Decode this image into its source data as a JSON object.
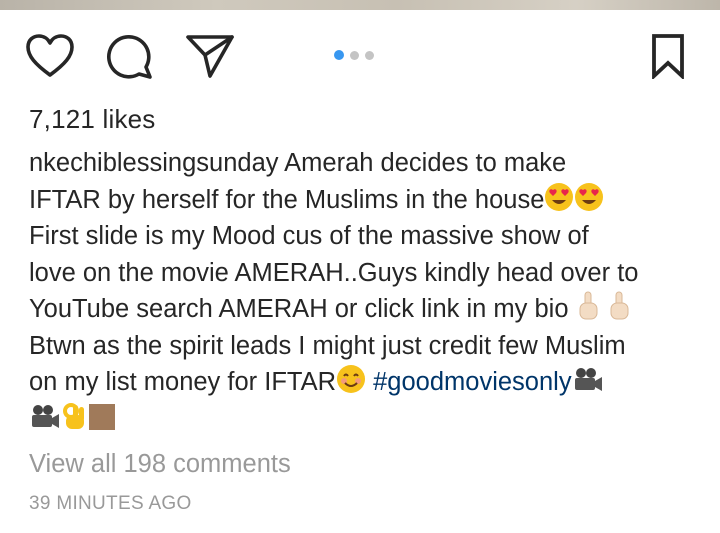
{
  "post": {
    "likes_text": "7,121 likes",
    "username": "nkechiblessingsunday",
    "caption_lines": [
      " Amerah decides to make",
      "IFTAR by herself for the Muslims in the house",
      "First slide is my Mood cus of the massive show of",
      "love on the movie AMERAH..Guys kindly head over to",
      "YouTube search AMERAH or click link in my bio",
      "Btwn as the spirit leads I might just credit few Muslim",
      "on my list money for IFTAR",
      "#goodmoviesonly"
    ],
    "view_comments_text": "View all 198 comments",
    "timestamp": "39 MINUTES AGO"
  },
  "carousel": {
    "total": 3,
    "active_index": 0
  },
  "icons": {
    "like": "heart-outline-icon",
    "comment": "speech-bubble-icon",
    "share": "paper-plane-icon",
    "save": "bookmark-outline-icon",
    "emojis": [
      "heart-eyes-emoji",
      "heart-eyes-emoji",
      "pointing-up-emoji",
      "pointing-up-emoji",
      "smiling-face-emoji",
      "movie-camera-emoji",
      "movie-camera-emoji",
      "ok-hand-emoji",
      "brown-square-emoji"
    ]
  },
  "colors": {
    "text": "#262626",
    "muted": "#999999",
    "hashtag": "#003569",
    "active_dot": "#3897f0",
    "inactive_dot": "#c4c4c4"
  }
}
